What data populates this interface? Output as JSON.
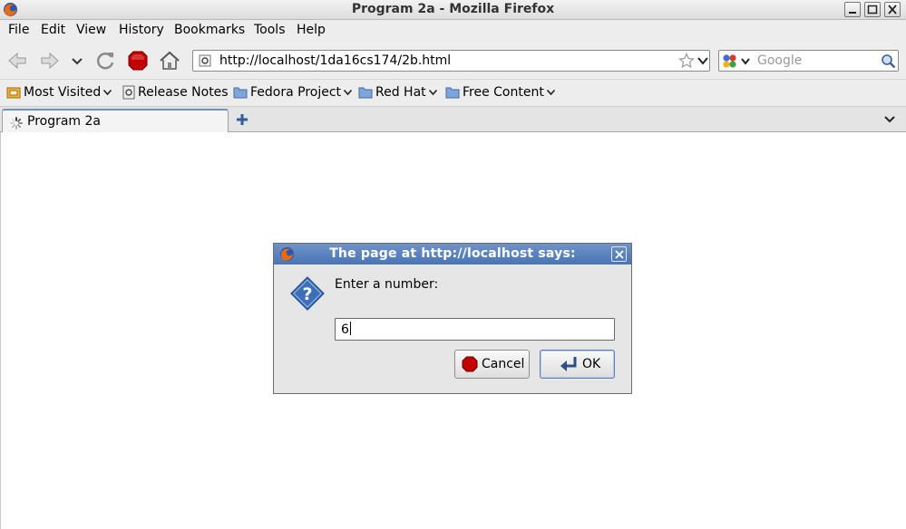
{
  "window": {
    "title": "Program 2a - Mozilla Firefox"
  },
  "menu": {
    "file": "File",
    "edit": "Edit",
    "view": "View",
    "history": "History",
    "bookmarks": "Bookmarks",
    "tools": "Tools",
    "help": "Help"
  },
  "nav": {
    "url": "http://localhost/1da16cs174/2b.html",
    "search_placeholder": "Google"
  },
  "bookmarks_bar": {
    "items": [
      "Most Visited",
      "Release Notes",
      "Fedora Project",
      "Red Hat",
      "Free Content"
    ]
  },
  "tabs": {
    "active_label": "Program 2a"
  },
  "dialog": {
    "title": "The page at http://localhost says:",
    "prompt": "Enter a number:",
    "input_value": "6",
    "cancel_label": "Cancel",
    "ok_label": "OK"
  },
  "colors": {
    "dialog_title_bg": "#4a74b4",
    "stop_red": "#cc0000"
  }
}
